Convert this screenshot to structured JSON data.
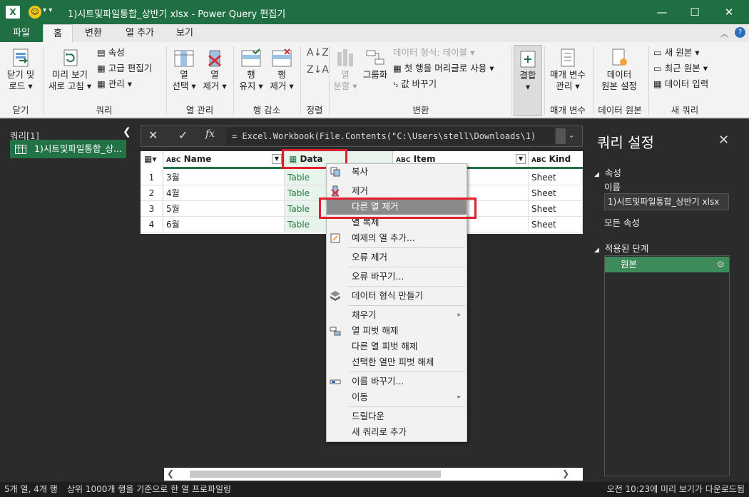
{
  "window": {
    "title": "1)시트및파일통합_상반기 xlsx - Power Query 편집기",
    "app_icon_label": "X"
  },
  "tabs": [
    {
      "label": "파일"
    },
    {
      "label": "홈"
    },
    {
      "label": "변환"
    },
    {
      "label": "열 추가"
    },
    {
      "label": "보기"
    }
  ],
  "ribbon": {
    "close_load": {
      "line1": "닫기 및",
      "line2": "로드 ▾",
      "group": "닫기"
    },
    "refresh": {
      "line1": "미리 보기",
      "line2": "새로 고침 ▾"
    },
    "properties": "속성",
    "advanced_editor": "고급 편집기",
    "manage": "관리 ▾",
    "query_group": "쿼리",
    "choose_columns": {
      "line1": "열",
      "line2": "선택 ▾"
    },
    "remove_columns": {
      "line1": "열",
      "line2": "제거 ▾"
    },
    "column_mgmt_group": "열 관리",
    "keep_rows": {
      "line1": "행",
      "line2": "유지 ▾"
    },
    "remove_rows": {
      "line1": "행",
      "line2": "제거 ▾"
    },
    "row_reduce_group": "행 감소",
    "sort_group": "정렬",
    "split_column": {
      "line1": "열",
      "line2": "분할 ▾"
    },
    "group_by": "그룹화",
    "data_type": "데이터 형식: 테이블 ▾",
    "first_row_header": "첫 행을 머리글로 사용 ▾",
    "replace_values": "값 바꾸기",
    "transform_group": "변환",
    "combine": {
      "line1": "결합",
      "line2": "▾"
    },
    "manage_params": {
      "line1": "매개 변수",
      "line2": "관리 ▾"
    },
    "params_group": "매개 변수",
    "data_source_settings": {
      "line1": "데이터",
      "line2": "원본 설정"
    },
    "data_source_group": "데이터 원본",
    "new_source": "새 원본 ▾",
    "recent_sources": "최근 원본 ▾",
    "enter_data": "데이터 입력",
    "new_query_group": "새 쿼리"
  },
  "left_pane": {
    "header": "쿼리[1]",
    "query_item": "1)시트및파일통합_상..."
  },
  "formula_bar": {
    "formula": "= Excel.Workbook(File.Contents(\"C:\\Users\\stell\\Downloads\\1)"
  },
  "grid": {
    "columns": [
      {
        "type_badge": "ABC",
        "name": "Name"
      },
      {
        "type_badge": "table",
        "name": "Data"
      },
      {
        "type_badge": "ABC",
        "name": "Item"
      },
      {
        "type_badge": "ABC",
        "name": "Kind"
      }
    ],
    "rows": [
      {
        "n": "1",
        "name": "3월",
        "data": "Table",
        "kind": "Sheet"
      },
      {
        "n": "2",
        "name": "4월",
        "data": "Table",
        "kind": "Sheet"
      },
      {
        "n": "3",
        "name": "5월",
        "data": "Table",
        "kind": "Sheet"
      },
      {
        "n": "4",
        "name": "6월",
        "data": "Table",
        "kind": "Sheet"
      }
    ]
  },
  "context_menu": {
    "items": [
      {
        "label": "복사",
        "icon": "copy-icon"
      },
      {
        "label": "제거",
        "icon": "remove-column-icon"
      },
      {
        "label": "다른 열 제거",
        "icon": ""
      },
      {
        "label": "열 복제",
        "icon": ""
      },
      {
        "label": "예제의 열 추가...",
        "icon": "column-from-examples-icon"
      },
      {
        "label": "오류 제거",
        "icon": ""
      },
      {
        "label": "오류 바꾸기...",
        "icon": ""
      },
      {
        "label": "데이터 형식 만들기",
        "icon": "data-type-icon"
      },
      {
        "label": "채우기",
        "icon": "",
        "submenu": true
      },
      {
        "label": "열 피벗 해제",
        "icon": "unpivot-icon"
      },
      {
        "label": "다른 열 피벗 해제",
        "icon": ""
      },
      {
        "label": "선택한 열만 피벗 해제",
        "icon": ""
      },
      {
        "label": "이름 바꾸기...",
        "icon": "rename-icon"
      },
      {
        "label": "이동",
        "icon": "",
        "submenu": true
      },
      {
        "label": "드릴다운",
        "icon": ""
      },
      {
        "label": "새 쿼리로 추가",
        "icon": ""
      }
    ]
  },
  "right_pane": {
    "title": "쿼리 설정",
    "properties_section": "속성",
    "name_label": "이름",
    "name_value": "1)시트및파일통합_상반기 xlsx",
    "all_properties": "모든 속성",
    "applied_steps": "적용된 단계",
    "steps": [
      "원본"
    ]
  },
  "status_bar": {
    "columns_rows": "5개 열, 4개 행",
    "profiling": "상위 1000개 행을 기준으로 한 열 프로파일링",
    "download_time": "오전 10:23에 미리 보기가 다운로드됨"
  },
  "colors": {
    "accent": "#217346",
    "highlight": "#e0202e",
    "dark_bg": "#2b2b2b"
  }
}
